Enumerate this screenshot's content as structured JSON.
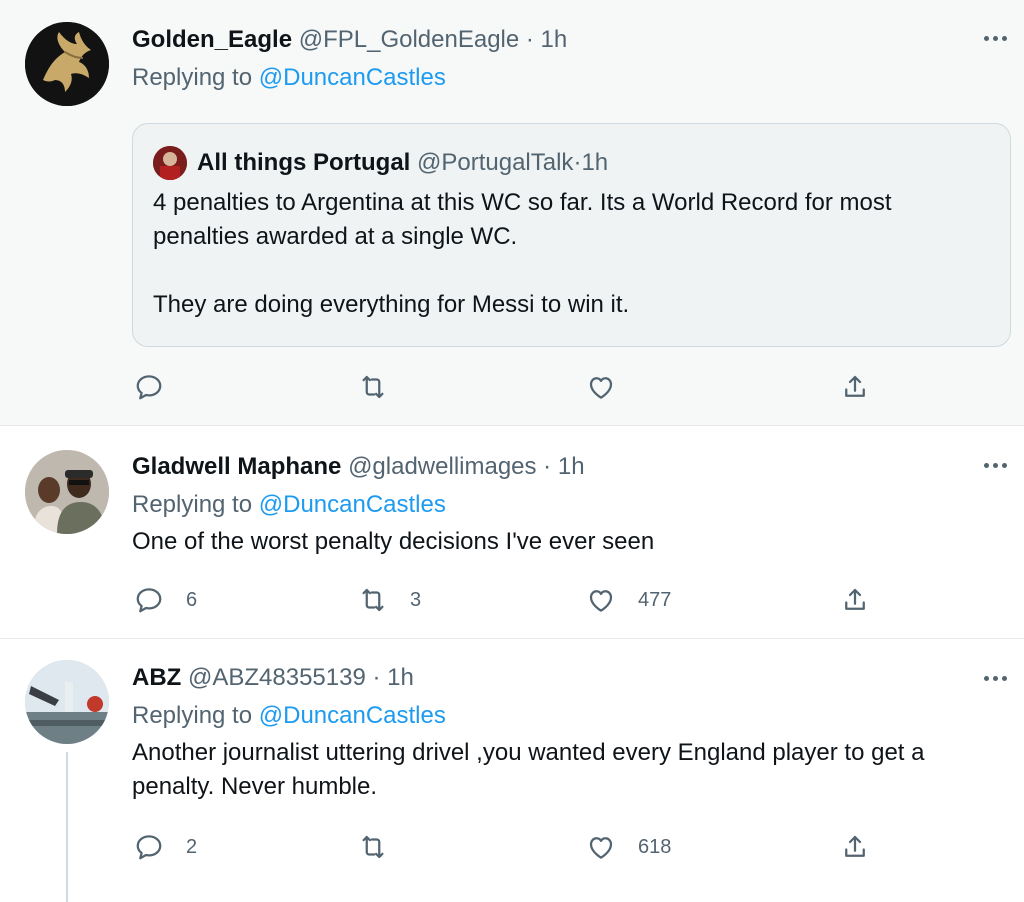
{
  "tweets": [
    {
      "name": "Golden_Eagle",
      "handle": "@FPL_GoldenEagle",
      "sep": " · ",
      "time": "1h",
      "replying_prefix": "Replying to ",
      "replying_to": "@DuncanCastles",
      "quote": {
        "name": "All things Portugal",
        "handle": "@PortugalTalk",
        "sep": " · ",
        "time": "1h",
        "text_lines": [
          "4 penalties to Argentina at this WC so far. Its a World Record for most penalties awarded at a single WC.",
          "They are doing everything for Messi to win it."
        ]
      },
      "actions": {
        "reply_count": "",
        "retweet_count": "",
        "like_count": ""
      }
    },
    {
      "name": "Gladwell Maphane",
      "handle": "@gladwellimages",
      "sep": " · ",
      "time": "1h",
      "replying_prefix": "Replying to ",
      "replying_to": "@DuncanCastles",
      "text": "One of the worst penalty decisions I've ever seen",
      "actions": {
        "reply_count": "6",
        "retweet_count": "3",
        "like_count": "477"
      }
    },
    {
      "name": "ABZ",
      "handle": "@ABZ48355139",
      "sep": " · ",
      "time": "1h",
      "replying_prefix": "Replying to ",
      "replying_to": "@DuncanCastles",
      "text": "Another journalist uttering drivel ,you wanted every England player to get a penalty. Never humble.",
      "actions": {
        "reply_count": "2",
        "retweet_count": "",
        "like_count": "618"
      }
    }
  ],
  "icons": {
    "reply": "reply-icon",
    "retweet": "retweet-icon",
    "like": "heart-icon",
    "share": "share-icon",
    "more": "more-options-icon"
  },
  "colors": {
    "link": "#1d9bf0",
    "secondary_text": "#536471",
    "primary_text": "#0f1419",
    "highlight_bg": "#f7f9f9"
  }
}
